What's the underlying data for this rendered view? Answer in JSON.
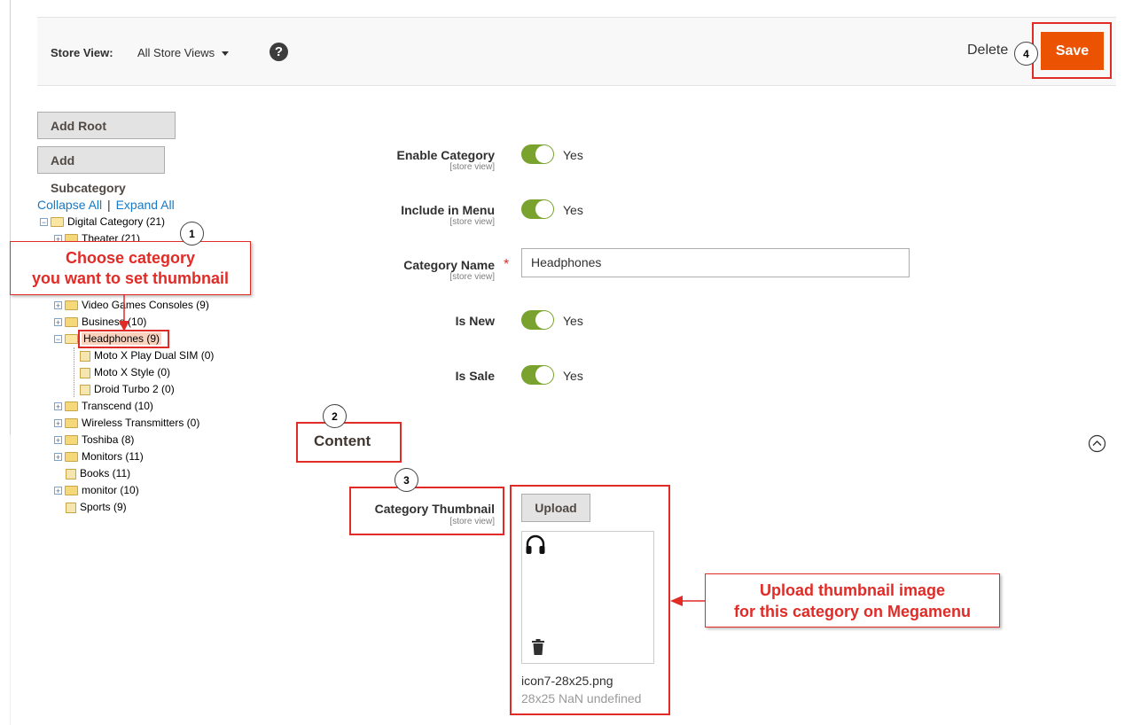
{
  "header": {
    "store_view_label": "Store View:",
    "store_view_value": "All Store Views",
    "help_symbol": "?",
    "delete_label": "Delete",
    "save_label": "Save"
  },
  "left": {
    "add_root_label": "Add Root Category",
    "add_sub_label": "Add Subcategory",
    "collapse_all": "Collapse All",
    "separator": "|",
    "expand_all": "Expand All"
  },
  "tree": {
    "root": "Digital Category (21)",
    "theater": "Theater (21)",
    "video_games": "Video Games Consoles (9)",
    "business": "Business (10)",
    "headphones": "Headphones (9)",
    "moto_dual": "Moto X Play Dual SIM (0)",
    "moto_style": "Moto X Style (0)",
    "droid": "Droid Turbo 2 (0)",
    "transcend": "Transcend (10)",
    "wireless": "Wireless Transmitters (0)",
    "toshiba": "Toshiba (8)",
    "monitors": "Monitors (11)",
    "books": "Books (11)",
    "monitor": "monitor (10)",
    "sports": "Sports (9)"
  },
  "form": {
    "enable_label": "Enable Category",
    "include_label": "Include in Menu",
    "name_label": "Category Name",
    "name_value": "Headphones",
    "is_new_label": "Is New",
    "is_sale_label": "Is Sale",
    "scope": "[store view]",
    "yes": "Yes",
    "required_mark": "*",
    "content_label": "Content",
    "thumbnail_label": "Category Thumbnail",
    "upload_label": "Upload",
    "file_name": "icon7-28x25.png",
    "file_meta": "28x25 NaN undefined"
  },
  "annotations": {
    "step1": "1",
    "step2": "2",
    "step3": "3",
    "step4": "4",
    "callout_choose_line1": "Choose category",
    "callout_choose_line2": "you want to set thumbnail",
    "callout_upload_line1": "Upload thumbnail image",
    "callout_upload_line2": "for this category on Megamenu"
  },
  "colors": {
    "accent_orange": "#eb5202",
    "annotation_red": "#e02b27",
    "toggle_green": "#79a22e",
    "link_blue": "#1979c3"
  },
  "icons": [
    "help-icon",
    "caret-down-icon",
    "folder-icon",
    "headphones-icon",
    "trash-icon",
    "collapse-circle-icon",
    "arrow-left-icon"
  ]
}
